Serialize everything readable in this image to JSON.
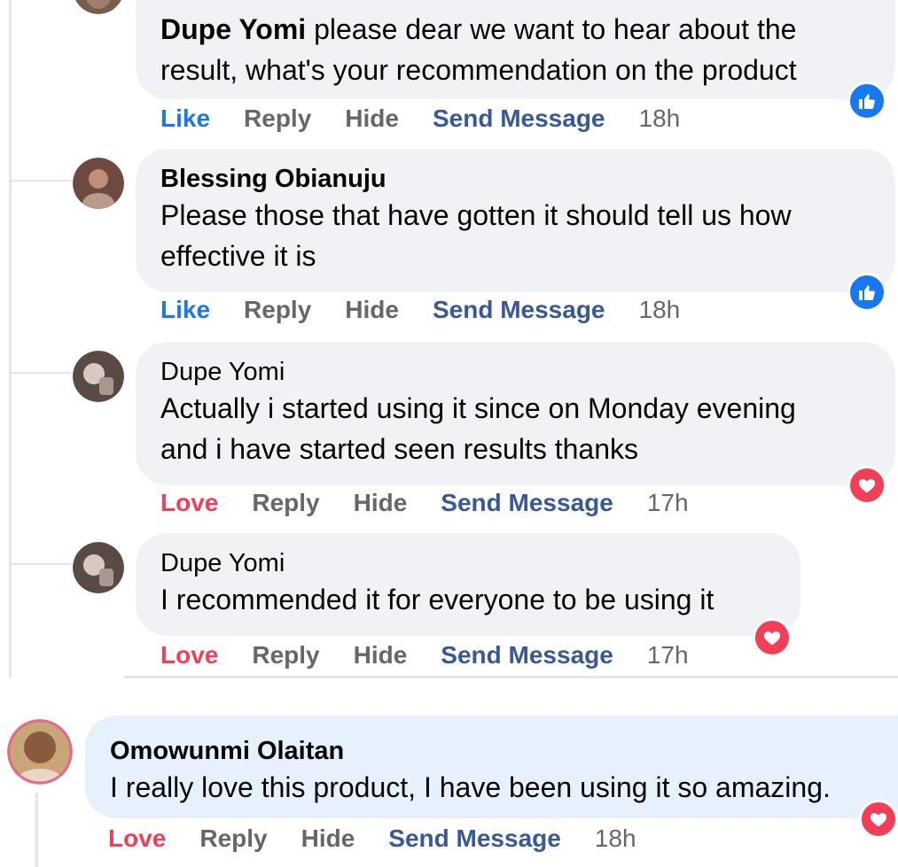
{
  "comments": [
    {
      "author": "Dupe Yomi",
      "text": "please dear we want to hear about the result, what's your recommendation on the product",
      "line1_rest": "please dear we want to hear about the",
      "line2": "result, what's your recommendation on the product",
      "reaction_label": "Like",
      "reply": "Reply",
      "hide": "Hide",
      "send": "Send Message",
      "time": "18h",
      "reaction_icon": "like-reaction-icon"
    },
    {
      "author": "Blessing Obianuju",
      "line1": "Please those that have gotten it should tell us how",
      "line2": "effective it is",
      "reaction_label": "Like",
      "reply": "Reply",
      "hide": "Hide",
      "send": "Send Message",
      "time": "18h",
      "reaction_icon": "like-reaction-icon"
    },
    {
      "author": "Dupe Yomi",
      "line1": "Actually i started using it since on Monday evening",
      "line2": "and i have started seen results thanks",
      "reaction_label": "Love",
      "reply": "Reply",
      "hide": "Hide",
      "send": "Send Message",
      "time": "17h",
      "reaction_icon": "love-reaction-icon"
    },
    {
      "author": "Dupe Yomi",
      "line1": "I recommended it for everyone to be using it",
      "reaction_label": "Love",
      "reply": "Reply",
      "hide": "Hide",
      "send": "Send Message",
      "time": "17h",
      "reaction_icon": "love-reaction-icon"
    },
    {
      "author": "Omowunmi Olaitan",
      "line1": "I really love this product, I have been using it so amazing.",
      "reaction_label": "Love",
      "reply": "Reply",
      "hide": "Hide",
      "send": "Send Message",
      "time": "18h",
      "reaction_icon": "love-reaction-icon"
    }
  ],
  "colors": {
    "like": "#1877f2",
    "love": "#f33e58",
    "secondary_text": "#65676b",
    "send_message": "#385898",
    "bubble": "#f0f2f5",
    "bubble_highlight": "#e7f0fd"
  }
}
